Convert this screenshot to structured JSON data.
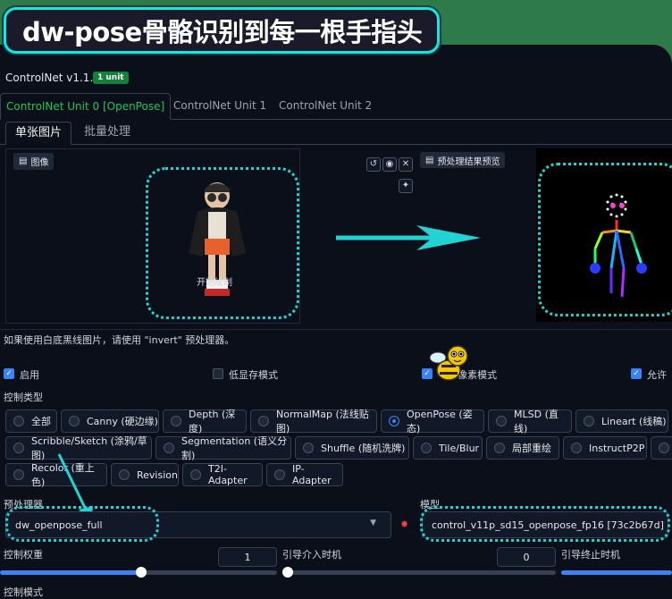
{
  "banner": {
    "text": "dw-pose骨骼识别到每一根手指头"
  },
  "header": {
    "title": "ControlNet v1.1.409",
    "badge": "1 unit"
  },
  "unit_tabs": [
    {
      "label": "ControlNet Unit 0 [OpenPose]",
      "active": true
    },
    {
      "label": "ControlNet Unit 1",
      "active": false
    },
    {
      "label": "ControlNet Unit 2",
      "active": false
    }
  ],
  "sub_tabs": [
    {
      "label": "单张图片",
      "active": true
    },
    {
      "label": "批量处理",
      "active": false
    }
  ],
  "image_panel": {
    "label": "图像",
    "overlay_text": "开始绘制"
  },
  "preview_panel": {
    "label": "预处理结果预览"
  },
  "hint_text": "如果使用白底黑线图片，请使用 \"invert\" 预处理器。",
  "options": [
    {
      "label": "启用",
      "checked": true
    },
    {
      "label": "低显存模式",
      "checked": false
    },
    {
      "label": "像素模式",
      "checked": true
    },
    {
      "label": "允许",
      "checked": true
    }
  ],
  "control_type": {
    "label": "控制类型",
    "items": [
      "全部",
      "Canny (硬边缘)",
      "Depth (深度)",
      "NormalMap (法线贴图)",
      "OpenPose (姿态)",
      "MLSD (直线)",
      "Lineart (线稿)",
      "Scribble/Sketch (涂鸦/草图)",
      "Segmentation (语义分割)",
      "Shuffle (随机洗牌)",
      "Tile/Blur",
      "局部重绘",
      "InstructP2P",
      "Recolor (重上色)",
      "Revision",
      "T2I-Adapter",
      "IP-Adapter"
    ],
    "selected": "OpenPose (姿态)"
  },
  "preprocessor": {
    "label": "预处理器",
    "value": "dw_openpose_full"
  },
  "model": {
    "label": "模型",
    "value": "control_v11p_sd15_openpose_fp16 [73c2b67d]"
  },
  "control_weight": {
    "label": "控制权重",
    "value": "1"
  },
  "start_step": {
    "label": "引导介入时机",
    "value": "0"
  },
  "end_step": {
    "label": "引导终止时机"
  },
  "bottom_label": "控制模式",
  "colors": {
    "accent": "#22c55e",
    "highlight": "#22d3d6",
    "checkbox": "#3b82f6"
  }
}
